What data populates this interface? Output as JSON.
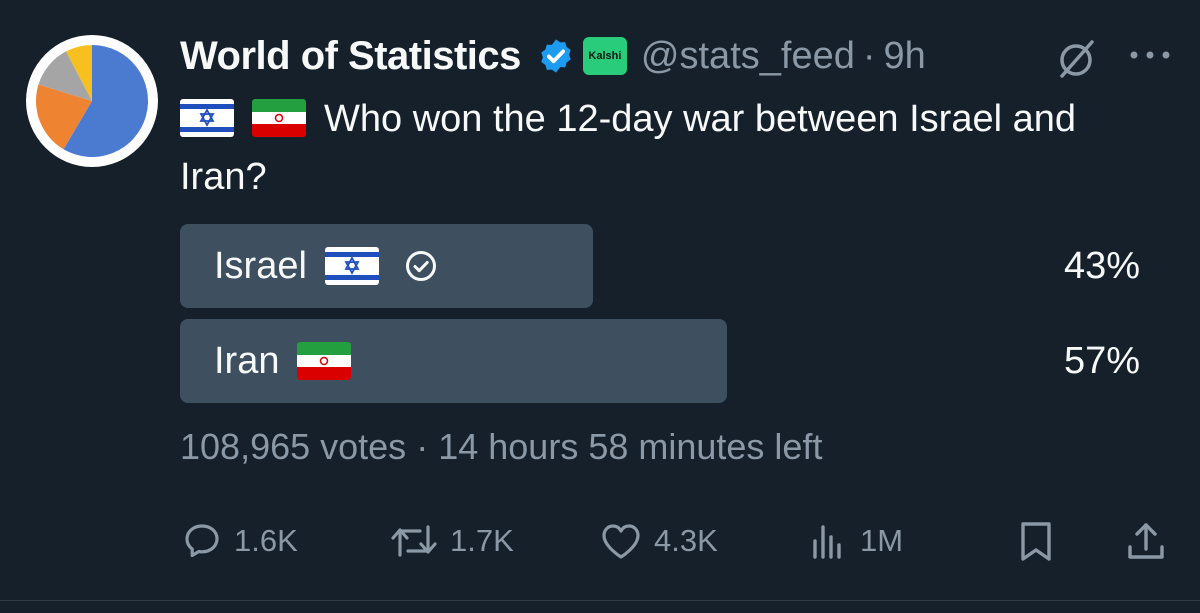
{
  "colors": {
    "background": "#15202b",
    "text": "#f7f9f9",
    "secondary_text": "#8b98a5",
    "poll_bar": "#3e4f5f",
    "verified_blue": "#1d9bf0",
    "kalshi_green": "#28cc7a"
  },
  "tweet": {
    "author_name": "World of Statistics",
    "badge_label": "Kalshi",
    "handle": "@stats_feed",
    "separator": "·",
    "time": "9h",
    "question": "Who won the 12-day war between Israel and Iran?",
    "avatar_icon": "pie-chart-avatar",
    "verified_icon": "verified-badge-icon"
  },
  "poll": {
    "options": [
      {
        "label": "Israel",
        "percent_label": "43%",
        "fraction": 0.43,
        "selected": true,
        "flag_icon": "israel-flag"
      },
      {
        "label": "Iran",
        "percent_label": "57%",
        "fraction": 0.57,
        "selected": false,
        "flag_icon": "iran-flag"
      }
    ],
    "votes": "108,965 votes",
    "separator": "·",
    "time_left": "14 hours 58 minutes left"
  },
  "actions": {
    "replies": "1.6K",
    "reposts": "1.7K",
    "likes": "4.3K",
    "views": "1M"
  }
}
